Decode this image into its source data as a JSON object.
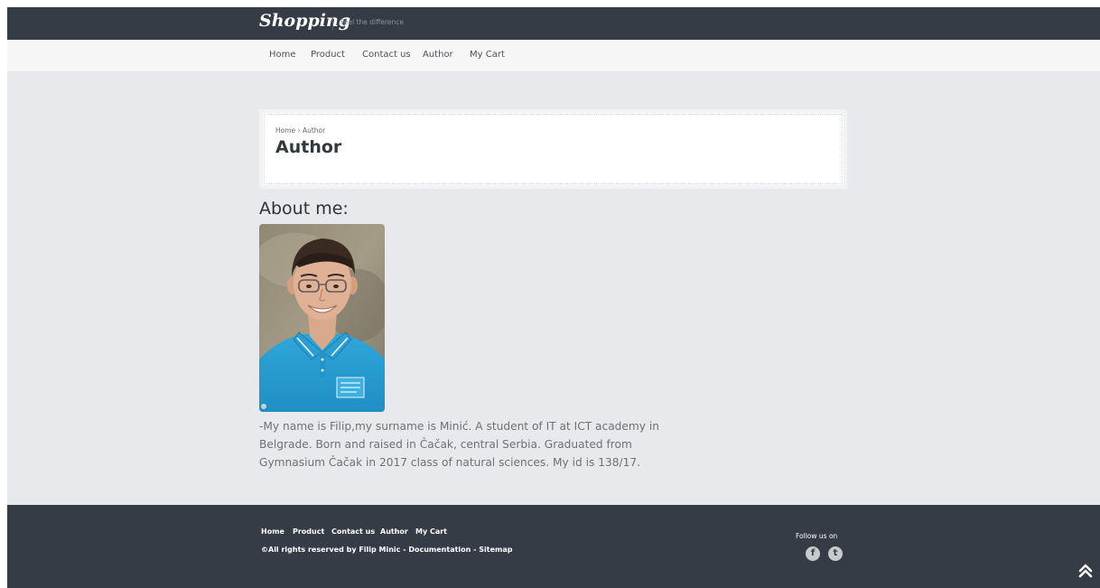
{
  "header": {
    "logo": "Shopping",
    "tagline": "Feel the difference"
  },
  "nav": {
    "items": [
      {
        "label": "Home"
      },
      {
        "label": "Product"
      },
      {
        "label": "Contact us"
      },
      {
        "label": "Author"
      },
      {
        "label": "My Cart"
      }
    ]
  },
  "breadcrumb": {
    "home": "Home",
    "separator": "›",
    "current": "Author"
  },
  "page": {
    "title": "Author",
    "about_heading": "About me:",
    "bio": "-My name is Filip,my surname is Minić. A student of IT at ICT academy in Belgrade. Born and raised in Čačak, central Serbia. Graduated from Gymnasium Čačak in 2017 class of natural sciences. My id is 138/17."
  },
  "footer": {
    "links": [
      {
        "label": "Home"
      },
      {
        "label": "Product"
      },
      {
        "label": "Contact us"
      },
      {
        "label": "Author"
      },
      {
        "label": "My Cart"
      }
    ],
    "copyright": "©All rights reserved by Filip Minic",
    "sep": "-",
    "documentation": "Documentation",
    "sitemap": "Sitemap",
    "follow": "Follow us on",
    "facebook_glyph": "f",
    "twitter_glyph": "t",
    "icons": [
      "facebook-icon",
      "twitter-icon",
      "scroll-to-top-icon"
    ]
  },
  "colors": {
    "header_bg": "#353c45",
    "nav_bg": "#f6f6f6",
    "content_bg": "#e7e9ec",
    "text": "#6d7276"
  }
}
